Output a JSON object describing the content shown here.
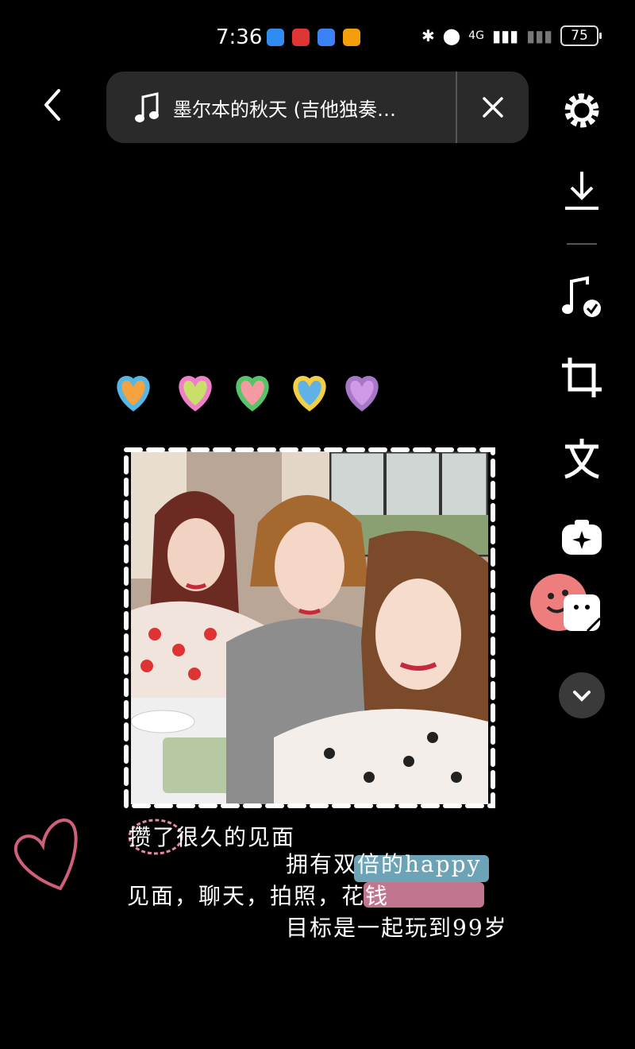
{
  "status_bar": {
    "time": "7:36",
    "network": "4G",
    "battery": "75"
  },
  "music": {
    "title": "墨尔本的秋天 (吉他独奏…"
  },
  "captions": {
    "line1": "攒了很久的见面",
    "line2": "拥有双倍的happy",
    "line3": "见面，聊天，拍照，花钱",
    "line4": "目标是一起玩到99岁"
  },
  "toolbar": {
    "items": [
      "settings-icon",
      "download-icon",
      "music-check-icon",
      "crop-icon",
      "text-icon",
      "effect-icon",
      "sticker-icon",
      "chevron-down-icon"
    ]
  },
  "colors": {
    "background": "#000000",
    "pill": "#2a2a2a",
    "highlight_blue": "#7fc0d6",
    "highlight_pink": "#e48aa7"
  }
}
